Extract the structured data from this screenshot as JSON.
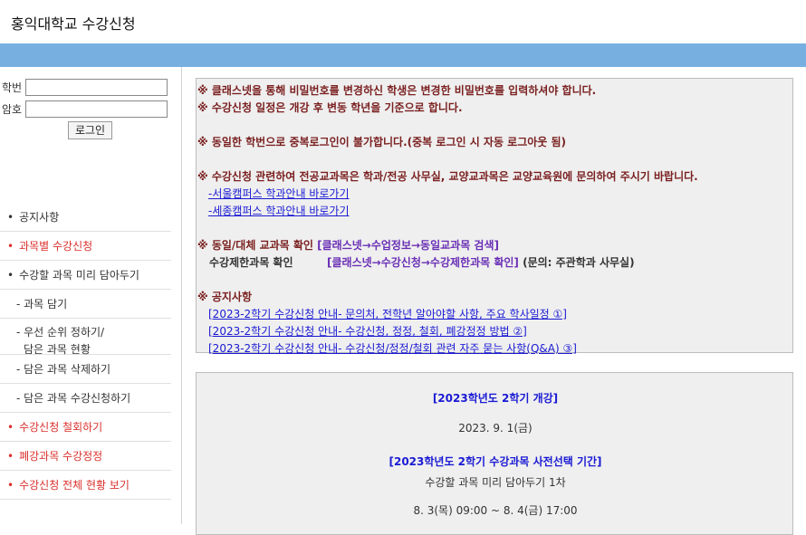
{
  "header": {
    "title": "홍익대학교 수강신청"
  },
  "login": {
    "id_label": "학번",
    "pw_label": "암호",
    "button_label": "로그인"
  },
  "menu": [
    {
      "label": "공지사항",
      "bullet": "•"
    },
    {
      "label": "과목별 수강신청",
      "bullet": "•"
    },
    {
      "label": "수강할 과목 미리 담아두기",
      "bullet": "•"
    },
    {
      "label": "- 과목 담기"
    },
    {
      "label": "- 우선 순위 정하기/",
      "label2": "담은 과목 현황"
    },
    {
      "label": "- 담은 과목 삭제하기"
    },
    {
      "label": "- 담은 과목 수강신청하기"
    },
    {
      "label": "수강신청 철회하기",
      "bullet": "•"
    },
    {
      "label": "폐강과목 수강정정",
      "bullet": "•"
    },
    {
      "label": "수강신청 전체 현황 보기",
      "bullet": "•"
    }
  ],
  "notice": {
    "line1": "※ 클래스넷을 통해 비밀번호를 변경하신 학생은 변경한 비밀번호를 입력하셔야 합니다.",
    "line2": "※ 수강신청 일정은 개강 후 변동 학년을 기준으로 합니다.",
    "line3": "※ 동일한 학번으로 중복로그인이 불가합니다.(중복 로그인 시 자동 로그아웃 됨)",
    "line4": "※ 수강신청 관련하여 전공교과목은 학과/전공 사무실, 교양교과목은 교양교육원에 문의하여 주시기 바랍니다.",
    "link_seoul": "-서울캠퍼스 학과안내 바로가기",
    "link_sejong": "-세종캠퍼스 학과안내 바로가기",
    "line5_prefix": "※ 동일/대체 교과목 확인 ",
    "line5_path": "[클래스넷→수업정보→동일교과목 검색]",
    "line6_prefix": "수강제한과목 확인",
    "line6_path": "[클래스넷→수강신청→수강제한과목 확인]",
    "line6_suffix": " (문의: 주관학과 사무실)",
    "notice_header": "※ 공지사항",
    "notice_links": [
      "[2023-2학기 수강신청 안내- 문의처, 전학년 알아야할 사항, 주요 학사일정 ①]",
      "[2023-2학기 수강신청 안내- 수강신청, 정정, 철회, 폐강정정 방법 ②]",
      "[2023-2학기 수강신청 안내- 수강신청/정정/철회 관련 자주 묻는 사항(Q&A) ③]"
    ]
  },
  "schedule": {
    "title": "[2023학년도 2학기 개강]",
    "date": "2023. 9. 1(금)",
    "period_title": "[2023학년도 2학기 수강과목 사전선택 기간]",
    "period_sub": "수강할 과목 미리 담아두기 1차",
    "period_time": "8. 3(목) 09:00 ~ 8. 4(금) 17:00"
  }
}
